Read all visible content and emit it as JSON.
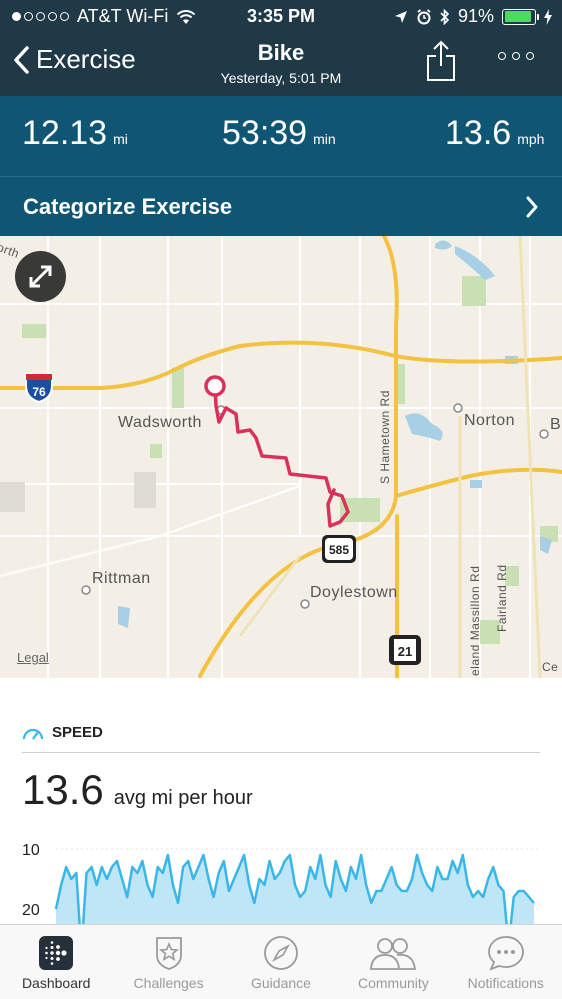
{
  "status_bar": {
    "carrier": "AT&T Wi-Fi",
    "time": "3:35 PM",
    "battery": "91%",
    "battery_level": 0.91
  },
  "nav": {
    "back_label": "Exercise",
    "title": "Bike",
    "subtitle": "Yesterday, 5:01 PM"
  },
  "stats": {
    "distance": {
      "value": "12.13",
      "unit": "mi"
    },
    "duration": {
      "value": "53:39",
      "unit": "min"
    },
    "speed": {
      "value": "13.6",
      "unit": "mph"
    }
  },
  "categorize_label": "Categorize Exercise",
  "map": {
    "labels": {
      "wadsworth": "Wadsworth",
      "norton": "Norton",
      "rittman": "Rittman",
      "doylestown": "Doylestown",
      "hametown": "S Hametown Rd",
      "massillon": "eland Massillon Rd",
      "fairland": "Fairland Rd",
      "north_edge": "orth",
      "b_edge": "B",
      "ce_edge": "Ce"
    },
    "shields": {
      "i76": "76",
      "sr585": "585",
      "sr21": "21"
    },
    "legal": "Legal"
  },
  "speed": {
    "heading": "SPEED",
    "average": "13.6",
    "average_label": "avg mi per hour",
    "y_ticks": [
      "20",
      "10"
    ]
  },
  "chart_data": {
    "type": "area",
    "title": "SPEED",
    "ylabel": "",
    "ylim": [
      0,
      20
    ],
    "y_ticks": [
      10,
      20
    ],
    "series": [
      {
        "values": [
          10,
          14,
          17,
          15,
          16,
          3,
          16,
          17,
          14,
          17,
          15,
          17,
          18,
          15,
          12,
          17,
          16,
          18,
          14,
          12,
          17,
          16,
          19,
          14,
          11,
          17,
          18,
          15,
          17,
          19,
          15,
          12,
          16,
          18,
          13,
          15,
          17,
          19,
          14,
          11,
          15,
          14,
          18,
          15,
          16,
          18,
          19,
          14,
          12,
          13,
          17,
          15,
          19,
          14,
          12,
          18,
          15,
          13,
          17,
          15,
          19,
          14,
          11,
          13,
          13,
          15,
          17,
          14,
          13,
          13,
          15,
          19,
          16,
          14,
          13,
          17,
          15,
          15,
          18,
          16,
          19,
          14,
          12,
          13,
          12,
          15,
          17,
          14,
          13,
          4,
          12,
          13,
          13,
          12,
          11
        ]
      }
    ]
  },
  "tabs": [
    {
      "label": "Dashboard",
      "icon": "dashboard-icon",
      "active": true
    },
    {
      "label": "Challenges",
      "icon": "challenges-star-icon",
      "active": false
    },
    {
      "label": "Guidance",
      "icon": "guidance-compass-icon",
      "active": false
    },
    {
      "label": "Community",
      "icon": "community-people-icon",
      "active": false
    },
    {
      "label": "Notifications",
      "icon": "notifications-chat-icon",
      "active": false
    }
  ],
  "colors": {
    "header_bg": "#1f3947",
    "stats_bg": "#0f5574",
    "route": "#d9325a",
    "chart_fill": "#bfe6f7",
    "chart_line": "#3ab6e8",
    "highway": "#f4c243"
  }
}
